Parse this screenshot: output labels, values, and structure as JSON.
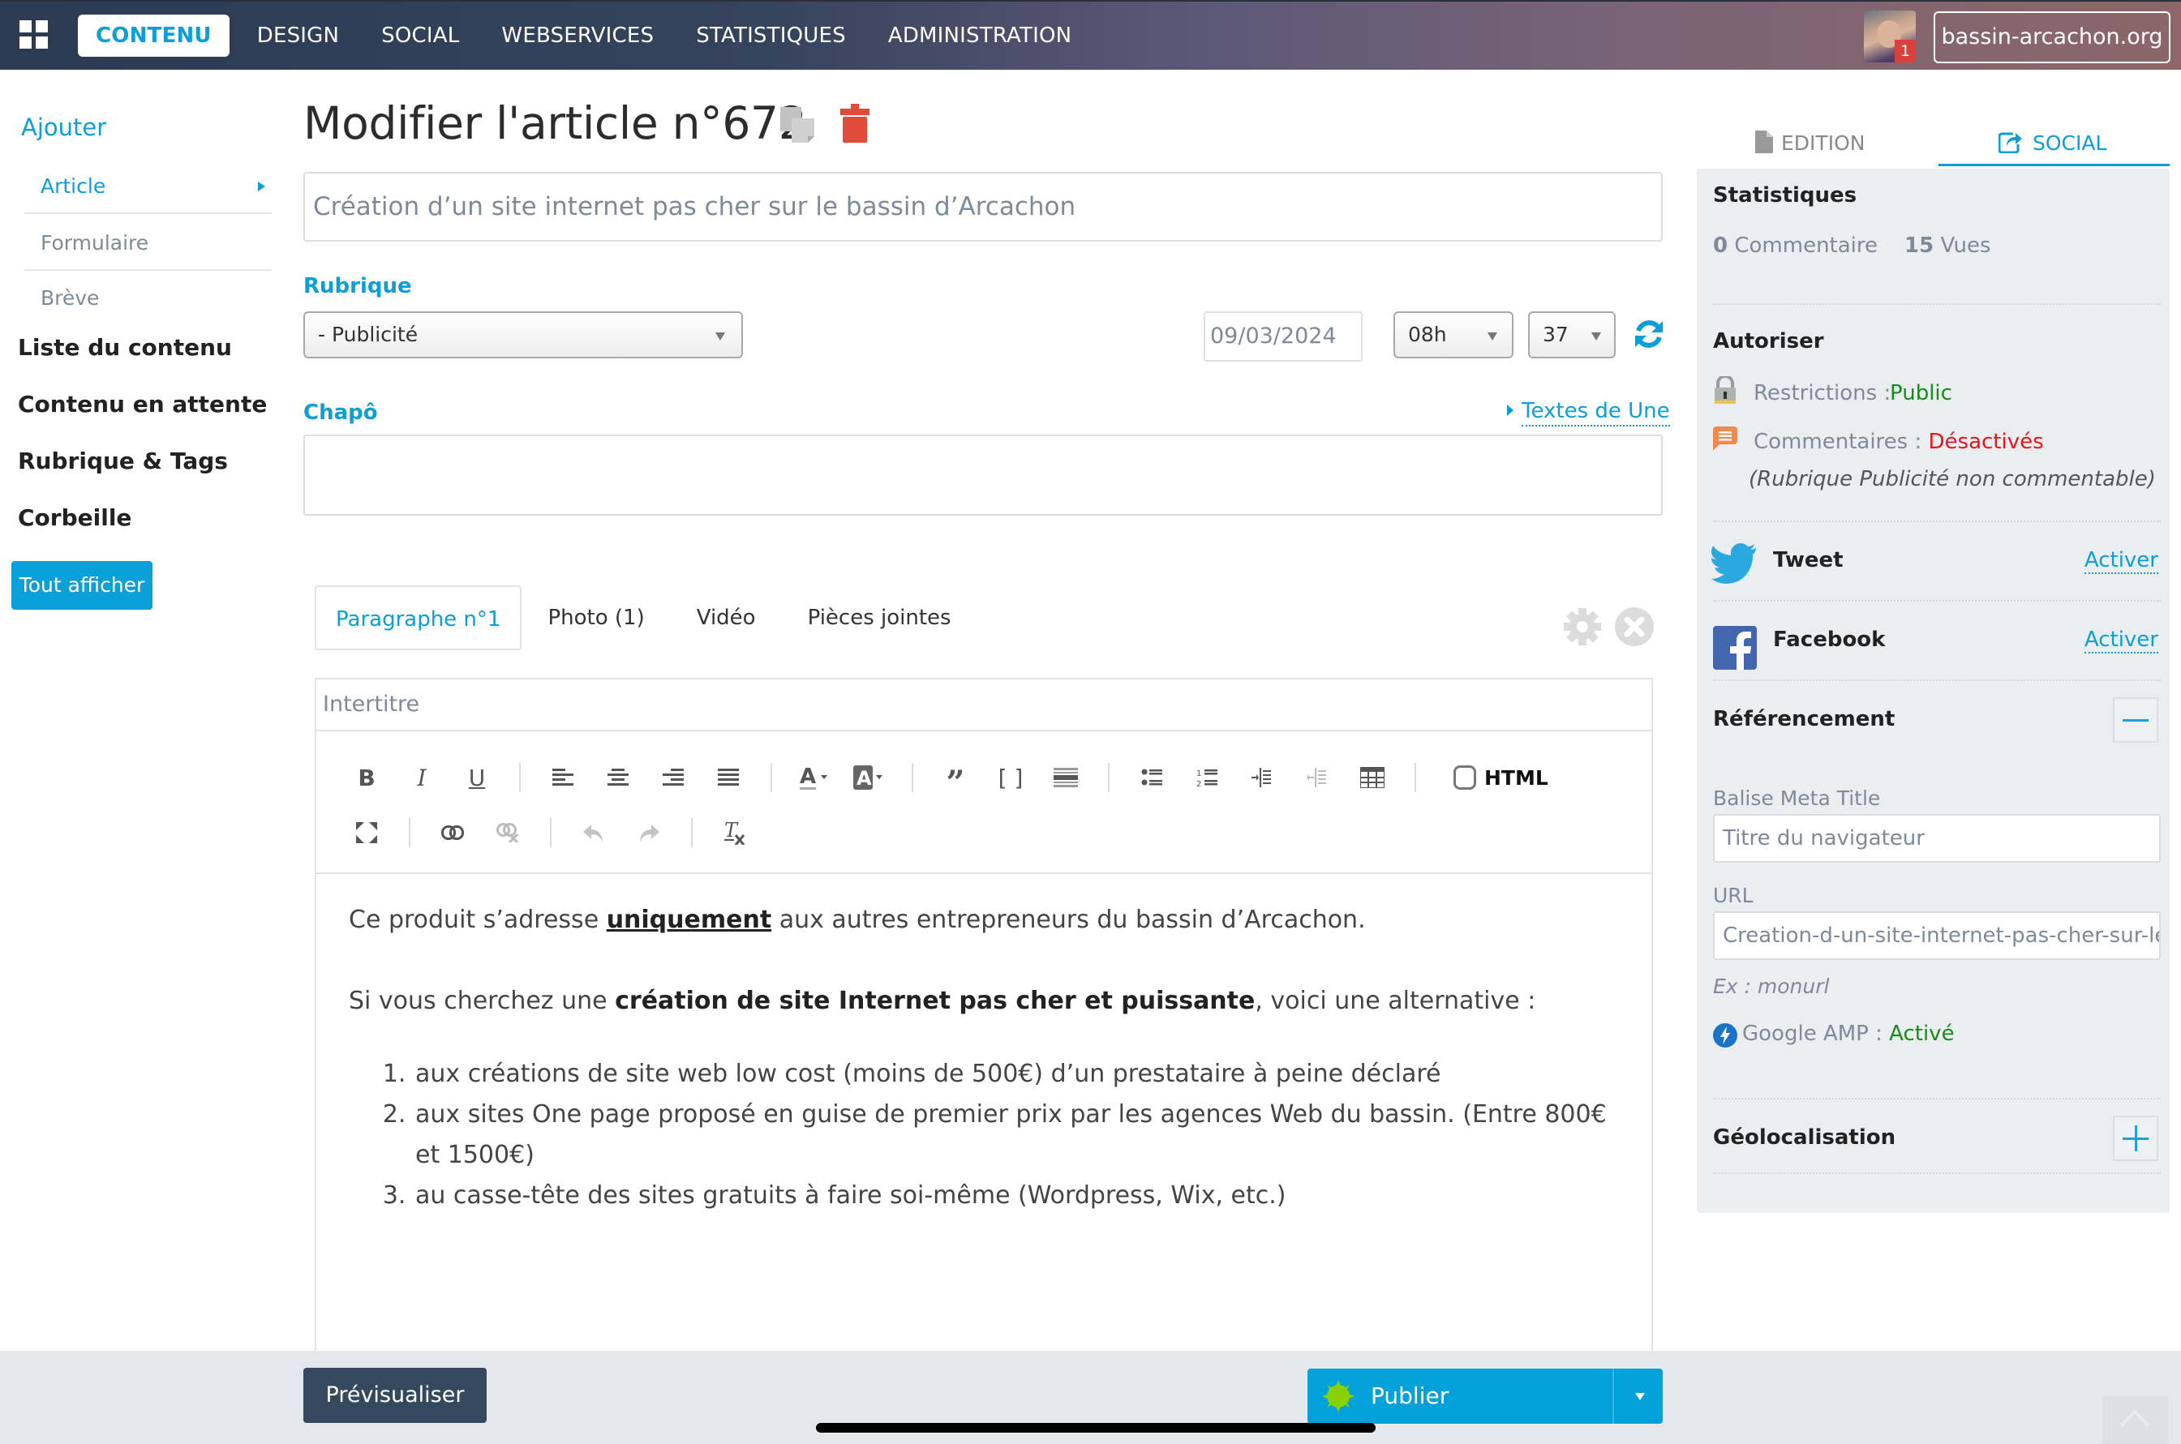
{
  "header": {
    "nav": [
      "CONTENU",
      "DESIGN",
      "SOCIAL",
      "WEBSERVICES",
      "STATISTIQUES",
      "ADMINISTRATION"
    ],
    "active_nav": "CONTENU",
    "notification_count": "1",
    "site_button": "bassin-arcachon.org"
  },
  "sidebar": {
    "heading": "Ajouter",
    "sub_items": [
      "Article",
      "Formulaire",
      "Brève"
    ],
    "main_items": [
      "Liste du contenu",
      "Contenu en attente",
      "Rubrique & Tags",
      "Corbeille"
    ],
    "show_all_button": "Tout afficher"
  },
  "main": {
    "page_title": "Modifier l'article n°672",
    "title_value": "Création d’un site internet pas cher sur le bassin d’Arcachon",
    "rubrique_label": "Rubrique",
    "rubrique_value": "- Publicité",
    "date_value": "09/03/2024",
    "hour_value": "08h",
    "minute_value": "37",
    "chapo_label": "Chapô",
    "textes_une_link": "Textes de Une",
    "chapo_value": ""
  },
  "tabs": [
    "Paragraphe n°1",
    "Photo (1)",
    "Vidéo",
    "Pièces jointes"
  ],
  "editor": {
    "intertitre_placeholder": "Intertitre",
    "html_toggle_label": "HTML",
    "html_checked": false,
    "p1_before": "Ce produit s’adresse ",
    "p1_bold": "uniquement",
    "p1_after": " aux autres entrepreneurs du bassin d’Arcachon.",
    "p2_before": "Si vous cherchez une ",
    "p2_bold": "création de site Internet pas cher et puissante",
    "p2_after": ", voici une alternative :",
    "list": [
      "aux créations de site web low cost (moins de 500€) d’un prestataire à peine déclaré",
      "aux sites One page proposé en guise de premier prix par les agences Web du bassin. (Entre 800€ et 1500€)",
      "au casse-tête des sites gratuits à faire soi-même (Wordpress, Wix, etc.)"
    ]
  },
  "right_panel": {
    "tabs": [
      "EDITION",
      "SOCIAL"
    ],
    "active_tab": "SOCIAL",
    "stats_heading": "Statistiques",
    "comments_count": "0",
    "comments_label": "Commentaire",
    "views_count": "15",
    "views_label": "Vues",
    "autoriser_heading": "Autoriser",
    "restrictions_label": "Restrictions :",
    "restrictions_value": "Public",
    "commentaires_label": "Commentaires :",
    "commentaires_value": "Désactivés",
    "commentaires_note": "(Rubrique Publicité non commentable)",
    "tweet_label": "Tweet",
    "tweet_action": "Activer",
    "facebook_label": "Facebook",
    "facebook_action": "Activer",
    "referencement_heading": "Référencement",
    "meta_title_label": "Balise Meta Title",
    "meta_title_placeholder": "Titre du navigateur",
    "url_label": "URL",
    "url_value": "Creation-d-un-site-internet-pas-cher-sur-le-bassin-d-Arcachon",
    "url_hint": "Ex : monurl",
    "amp_label": "Google AMP :",
    "amp_value": "Activé",
    "geoloc_heading": "Géolocalisation"
  },
  "footer": {
    "preview_button": "Prévisualiser",
    "publish_button": "Publier"
  },
  "colors": {
    "accent": "#0b9ed8",
    "danger": "#e04b3a",
    "success": "#1a8a1a",
    "error_red": "#e8141c",
    "preview_btn": "#34495e",
    "publish_btn": "#03a1d9"
  }
}
